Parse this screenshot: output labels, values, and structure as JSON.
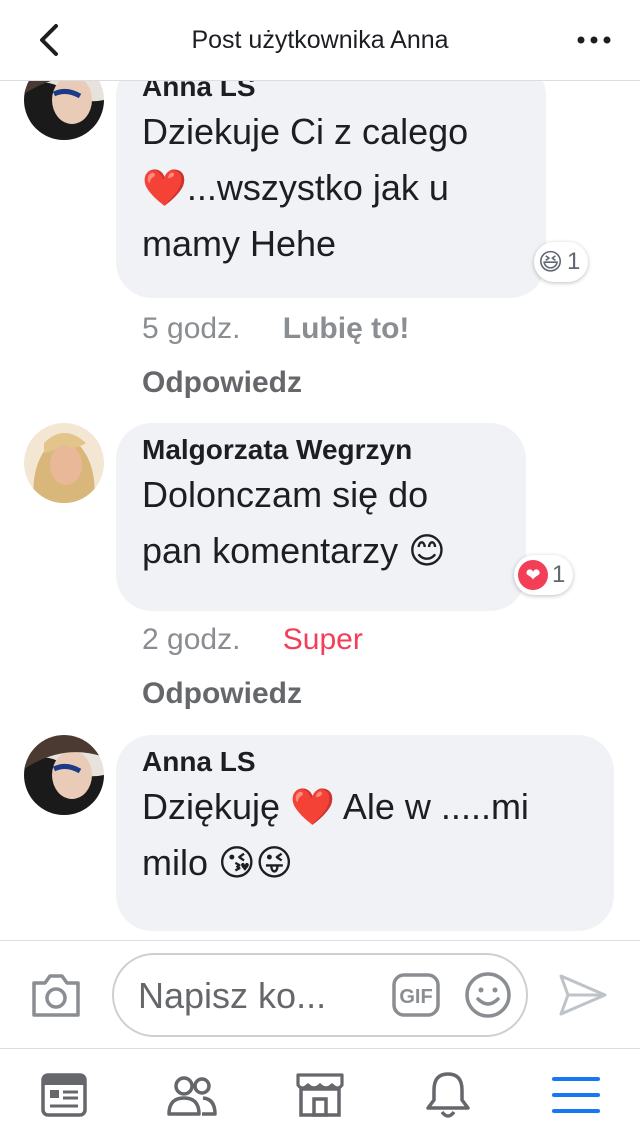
{
  "header": {
    "title": "Post użytkownika Anna"
  },
  "comments": [
    {
      "author": "Anna LS",
      "lines": [
        "Dziekuje Ci z calego",
        "❤️...wszystko jak u",
        "mamy Hehe"
      ],
      "reaction": {
        "emoji": "😆",
        "count": "1"
      },
      "time": "5 godz.",
      "action": "Lubię to!",
      "reply": "Odpowiedz"
    },
    {
      "author": "Malgorzata Wegrzyn",
      "lines": [
        "Dolonczam się do",
        "pan komentarzy 😊"
      ],
      "reaction": {
        "emoji": "❤",
        "count": "1"
      },
      "time": "2 godz.",
      "action": "Super",
      "reply": "Odpowiedz"
    },
    {
      "author": "Anna LS",
      "lines": [
        "Dziękuję ❤️ Ale w .....mi",
        "milo 😘😜"
      ]
    }
  ],
  "composer": {
    "placeholder": "Napisz ko...",
    "gif_label": "GIF"
  },
  "icons": {
    "back": "chevron-left-icon",
    "more": "more-dots-icon",
    "camera": "camera-icon",
    "gif": "gif-icon",
    "emoji": "smiley-icon",
    "send": "send-icon"
  },
  "tabs": [
    "news-feed",
    "friends",
    "marketplace",
    "notifications",
    "menu"
  ],
  "colors": {
    "accent": "#1877f2",
    "super": "#f33e58",
    "bubble": "#f0f2f5"
  }
}
